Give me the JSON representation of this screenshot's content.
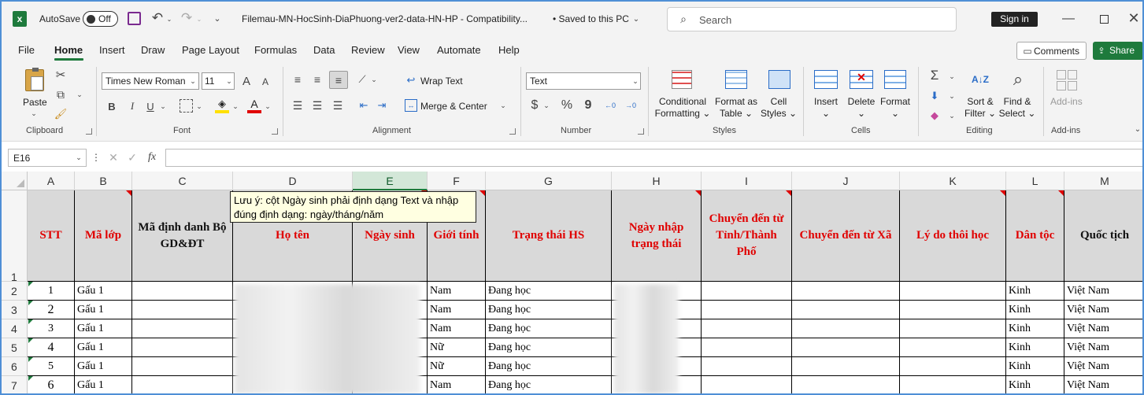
{
  "titlebar": {
    "autosave_label": "AutoSave",
    "autosave_state": "Off",
    "filename": "Filemau-MN-HocSinh-DiaPhuong-ver2-data-HN-HP  -  Compatibility...",
    "saved_status": "• Saved to this PC",
    "search_placeholder": "Search",
    "signin_label": "Sign in"
  },
  "menu": {
    "items": [
      "File",
      "Home",
      "Insert",
      "Draw",
      "Page Layout",
      "Formulas",
      "Data",
      "Review",
      "View",
      "Automate",
      "Help"
    ],
    "active": "Home",
    "comments_label": "Comments",
    "share_label": "Share"
  },
  "ribbon": {
    "clipboard": {
      "paste": "Paste",
      "group": "Clipboard"
    },
    "font": {
      "name": "Times New Roman",
      "size": "11",
      "group": "Font",
      "bold": "B",
      "italic": "I",
      "underline": "U",
      "grow": "A",
      "shrink": "A",
      "font_color": "A"
    },
    "alignment": {
      "wrap_text": "Wrap Text",
      "merge_center": "Merge & Center",
      "group": "Alignment"
    },
    "number": {
      "format": "Text",
      "group": "Number",
      "currency": "$",
      "percent": "%",
      "comma": "9"
    },
    "styles": {
      "conditional": [
        "Conditional",
        "Formatting"
      ],
      "format_table": [
        "Format as",
        "Table"
      ],
      "cell_styles": [
        "Cell",
        "Styles"
      ],
      "group": "Styles"
    },
    "cells": {
      "insert": "Insert",
      "delete": "Delete",
      "format": "Format",
      "group": "Cells"
    },
    "editing": {
      "sort_filter": [
        "Sort &",
        "Filter"
      ],
      "find_select": [
        "Find &",
        "Select"
      ],
      "group": "Editing",
      "sigma": "Σ"
    },
    "addins": {
      "label": "Add-ins",
      "group": "Add-ins"
    }
  },
  "formula_bar": {
    "name_box": "E16",
    "fx": "fx",
    "value": ""
  },
  "sheet": {
    "columns": [
      "A",
      "B",
      "C",
      "D",
      "E",
      "F",
      "G",
      "H",
      "I",
      "J",
      "K",
      "L",
      "M"
    ],
    "selected_column": "E",
    "row_numbers": [
      "1",
      "2",
      "3",
      "4",
      "5",
      "6",
      "7"
    ],
    "headers": [
      "STT",
      "Mã lớp",
      "Mã định danh Bộ GD&ĐT",
      "Họ tên",
      "Ngày sinh",
      "Giới tính",
      "Trạng thái HS",
      "Ngày nhập trạng thái",
      "Chuyển đến từ Tỉnh/Thành Phố",
      "Chuyển đến từ Xã",
      "Lý do thôi học",
      "Dân tộc",
      "Quốc tịch"
    ],
    "rows": [
      [
        "1",
        "Gấu 1",
        "",
        "",
        "",
        "Nam",
        "Đang học",
        "",
        "",
        "",
        "",
        "Kinh",
        "Việt Nam"
      ],
      [
        "2",
        "Gấu 1",
        "",
        "",
        "",
        "Nam",
        "Đang học",
        "",
        "",
        "",
        "",
        "Kinh",
        "Việt Nam"
      ],
      [
        "3",
        "Gấu 1",
        "",
        "",
        "",
        "Nam",
        "Đang học",
        "",
        "",
        "",
        "",
        "Kinh",
        "Việt Nam"
      ],
      [
        "4",
        "Gấu 1",
        "",
        "",
        "",
        "Nữ",
        "Đang học",
        "",
        "",
        "",
        "",
        "Kinh",
        "Việt Nam"
      ],
      [
        "5",
        "Gấu 1",
        "",
        "",
        "",
        "Nữ",
        "Đang học",
        "",
        "",
        "",
        "",
        "Kinh",
        "Việt Nam"
      ],
      [
        "6",
        "Gấu 1",
        "",
        "",
        "",
        "Nam",
        "Đang học",
        "",
        "",
        "",
        "",
        "Kinh",
        "Việt Nam"
      ]
    ],
    "tooltip": "Lưu ý: cột Ngày sinh phải định dạng Text và nhập đúng định dạng: ngày/tháng/năm",
    "header_color": "#e00000",
    "header_fill": "#d9d9d9"
  }
}
